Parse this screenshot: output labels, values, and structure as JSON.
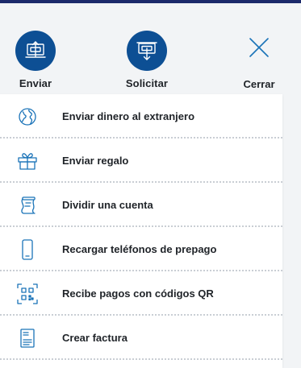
{
  "actions": {
    "send": {
      "label": "Enviar",
      "icon": "send-money-icon"
    },
    "request": {
      "label": "Solicitar",
      "icon": "request-money-icon"
    },
    "close": {
      "label": "Cerrar",
      "icon": "close-icon"
    }
  },
  "menu": {
    "items": [
      {
        "label": "Enviar dinero al extranjero",
        "icon": "globe-icon"
      },
      {
        "label": "Enviar regalo",
        "icon": "gift-icon"
      },
      {
        "label": "Dividir una cuenta",
        "icon": "split-bill-icon"
      },
      {
        "label": "Recargar teléfonos de prepago",
        "icon": "mobile-phone-icon"
      },
      {
        "label": "Recibe pagos con códigos QR",
        "icon": "qr-code-icon"
      },
      {
        "label": "Crear factura",
        "icon": "invoice-icon"
      }
    ]
  },
  "colors": {
    "accent": "#0d4f94",
    "icon_stroke": "#1a73b8",
    "top_strip": "#1c2a6b",
    "background": "#f2f4f6"
  }
}
